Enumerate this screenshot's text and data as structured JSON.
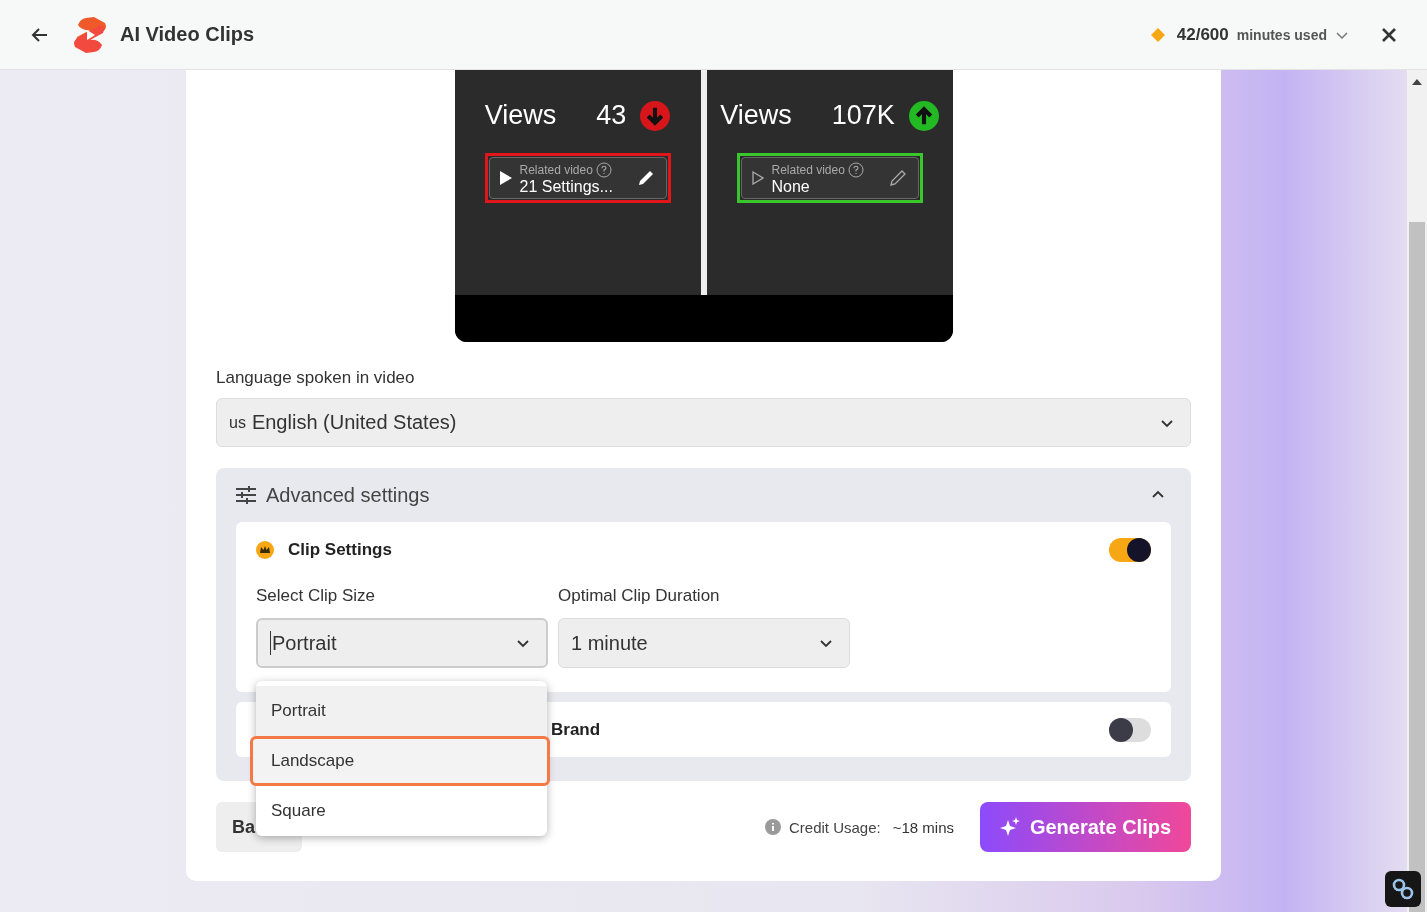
{
  "header": {
    "title": "AI Video Clips",
    "usage_count": "42/600",
    "usage_label": "minutes used"
  },
  "preview": {
    "panels": [
      {
        "label": "Views",
        "value": "43",
        "kind": "decrease",
        "related_label": "Related video",
        "related_value": "21 Settings...",
        "color": "#e0161b",
        "filled": true
      },
      {
        "label": "Views",
        "value": "107K",
        "kind": "increase",
        "related_label": "Related video",
        "related_value": "None",
        "color": "#3ac62d",
        "filled": false
      }
    ]
  },
  "language": {
    "label": "Language spoken in video",
    "flag": "us",
    "value": "English (United States)"
  },
  "advanced": {
    "title": "Advanced settings",
    "expanded": true,
    "clip_settings": {
      "title": "Clip Settings",
      "on": true,
      "size": {
        "label": "Select Clip Size",
        "value": "Portrait"
      },
      "duration": {
        "label": "Optimal Clip Duration",
        "value": "1 minute"
      }
    },
    "brand": {
      "title": "Brand",
      "on": false
    }
  },
  "dropdown": {
    "options": [
      {
        "label": "Portrait",
        "selected": true,
        "hovered": false
      },
      {
        "label": "Landscape",
        "selected": false,
        "hovered": true
      },
      {
        "label": "Square",
        "selected": false,
        "hovered": false
      }
    ]
  },
  "footer": {
    "back": "Ba",
    "credit_label": "Credit Usage:",
    "credit_value": "~18 mins",
    "generate": "Generate Clips"
  }
}
